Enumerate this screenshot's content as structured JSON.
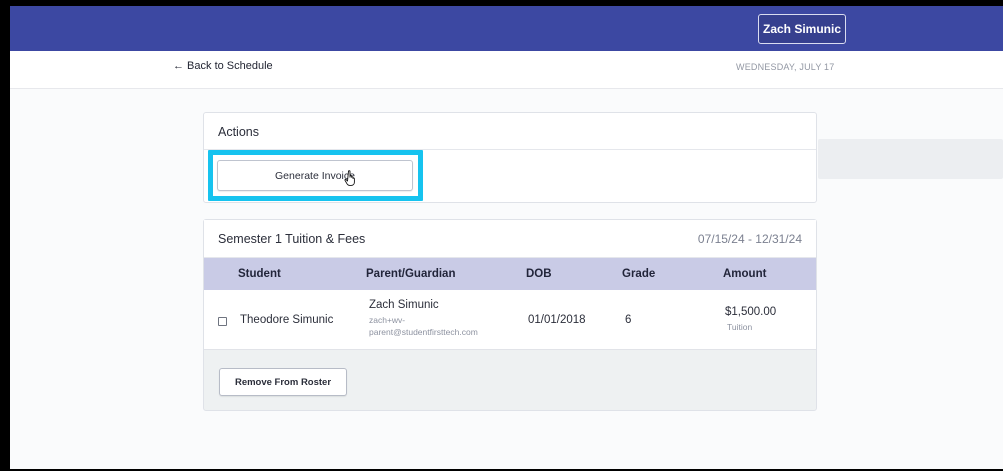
{
  "header": {
    "user_name": "Zach Simunic",
    "back_link": "← Back to Schedule",
    "date": "WEDNESDAY, JULY 17"
  },
  "actions": {
    "title": "Actions",
    "generate_invoice_label": "Generate Invoice"
  },
  "semester": {
    "title": "Semester 1 Tuition & Fees",
    "date_range": "07/15/24 - 12/31/24",
    "columns": [
      "Student",
      "Parent/Guardian",
      "DOB",
      "Grade",
      "Amount"
    ],
    "rows": [
      {
        "student": "Theodore Simunic",
        "parent_name": "Zach Simunic",
        "parent_email_line1": "zach+wv-",
        "parent_email_line2": "parent@studentfirsttech.com",
        "dob": "01/01/2018",
        "grade": "6",
        "amount": "$1,500.00",
        "amount_type": "Tuition",
        "checked": false
      }
    ],
    "remove_label": "Remove From Roster"
  },
  "colors": {
    "navbar": "#3c48a2",
    "highlight": "#16c3ef",
    "table_header": "#c9cbe6"
  },
  "icons": {
    "cursor": "hand-pointer-icon"
  }
}
